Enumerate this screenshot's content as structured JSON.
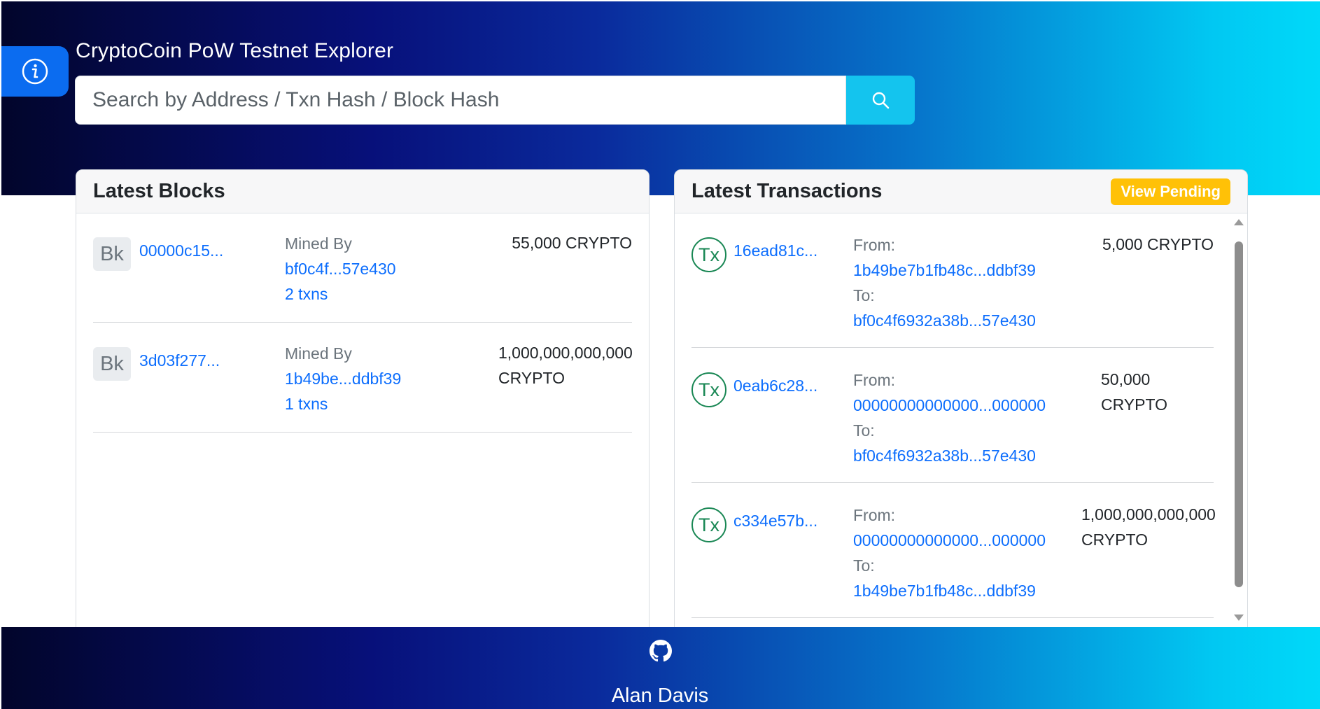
{
  "header": {
    "title": "CryptoCoin PoW Testnet Explorer",
    "search_placeholder": "Search by Address / Txn Hash / Block Hash",
    "info_icon": "info-circle-icon",
    "search_icon": "search-icon"
  },
  "blocks": {
    "title": "Latest Blocks",
    "badge": "Bk",
    "mined_by_label": "Mined By",
    "items": [
      {
        "hash": "00000c15...",
        "miner": "bf0c4f...57e430",
        "txns": "2 txns",
        "reward_line1": "55,000 CRYPTO",
        "reward_line2": ""
      },
      {
        "hash": "3d03f277...",
        "miner": "1b49be...ddbf39",
        "txns": "1 txns",
        "reward_line1": "1,000,000,000,000",
        "reward_line2": "CRYPTO"
      }
    ]
  },
  "transactions": {
    "title": "Latest Transactions",
    "view_pending_label": "View Pending",
    "badge": "Tx",
    "from_label": "From:",
    "to_label": "To:",
    "items": [
      {
        "hash": "16ead81c...",
        "from": "1b49be7b1fb48c...ddbf39",
        "to": "bf0c4f6932a38b...57e430",
        "amount_line1": "5,000 CRYPTO",
        "amount_line2": ""
      },
      {
        "hash": "0eab6c28...",
        "from": "00000000000000...000000",
        "to": "bf0c4f6932a38b...57e430",
        "amount_line1": "50,000",
        "amount_line2": "CRYPTO"
      },
      {
        "hash": "c334e57b...",
        "from": "00000000000000...000000",
        "to": "1b49be7b1fb48c...ddbf39",
        "amount_line1": "1,000,000,000,000",
        "amount_line2": "CRYPTO"
      }
    ]
  },
  "footer": {
    "github_icon": "github-icon",
    "author": "Alan Davis"
  },
  "colors": {
    "link": "#0d6efd",
    "accent_button": "#14c4ee",
    "info_button": "#0b6cf0",
    "pending_button": "#ffc107",
    "tx_badge": "#198754"
  }
}
